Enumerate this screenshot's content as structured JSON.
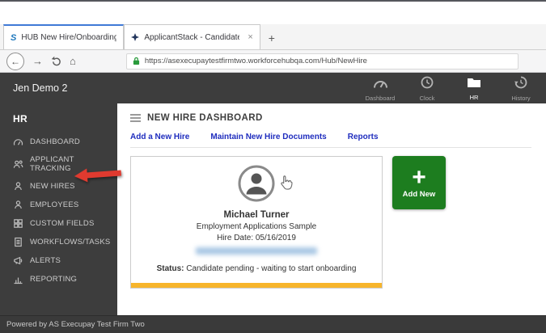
{
  "browser": {
    "tabs": [
      {
        "title": "HUB New Hire/Onboarding Pa",
        "icon": "swipeclock-s-icon",
        "icon_text": "S",
        "active": true
      },
      {
        "title": "ApplicantStack - Candidates",
        "icon": "applicantstack-icon",
        "active": false
      }
    ],
    "new_tab_glyph": "+",
    "close_glyph": "×",
    "nav": {
      "back_glyph": "←",
      "forward_glyph": "→",
      "home_glyph": "⌂"
    },
    "url": "https://asexecupaytestfirmtwo.workforcehubqa.com/Hub/NewHire"
  },
  "app_header": {
    "title": "Jen Demo 2",
    "nav": [
      {
        "label": "Dashboard",
        "icon": "dashboard-icon",
        "active": false
      },
      {
        "label": "Clock",
        "icon": "clock-icon",
        "active": false
      },
      {
        "label": "HR",
        "icon": "hr-folder-icon",
        "active": true
      },
      {
        "label": "History",
        "icon": "history-icon",
        "active": false
      }
    ]
  },
  "sidebar": {
    "section_label": "HR",
    "items": [
      {
        "label": "DASHBOARD",
        "icon": "gauge-icon"
      },
      {
        "label": "APPLICANT TRACKING",
        "icon": "people-icon"
      },
      {
        "label": "NEW HIRES",
        "icon": "person-icon",
        "annotated": true
      },
      {
        "label": "EMPLOYEES",
        "icon": "person-icon"
      },
      {
        "label": "CUSTOM FIELDS",
        "icon": "grid-icon"
      },
      {
        "label": "WORKFLOWS/TASKS",
        "icon": "tasks-icon"
      },
      {
        "label": "ALERTS",
        "icon": "megaphone-icon"
      },
      {
        "label": "REPORTING",
        "icon": "bar-chart-icon"
      }
    ]
  },
  "main": {
    "title": "NEW HIRE DASHBOARD",
    "links": [
      {
        "label": "Add a New Hire"
      },
      {
        "label": "Maintain New Hire Documents"
      },
      {
        "label": "Reports"
      }
    ],
    "card": {
      "name": "Michael Turner",
      "subtitle": "Employment Applications Sample",
      "hire_date": "Hire Date: 05/16/2019",
      "status_label": "Status:",
      "status_text": " Candidate pending - waiting to start onboarding"
    },
    "add_new_glyph": "+",
    "add_new_label": "Add New"
  },
  "footer": {
    "text": "Powered by AS Execupay Test Firm Two"
  },
  "colors": {
    "accent_green": "#1d7d1f",
    "highlight_yellow": "#f7b52c",
    "arrow_red": "#e03a2f",
    "link_blue": "#1f2dbe",
    "header_bg": "#3d3d3d"
  }
}
